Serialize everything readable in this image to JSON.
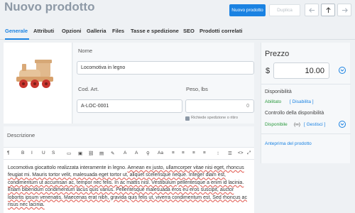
{
  "header": {
    "title": "Nuovo prodotto",
    "create_label": "Nuovo prodotto",
    "duplicate_label": "Duplica"
  },
  "tabs": [
    {
      "label": "Generale"
    },
    {
      "label": "Attributi"
    },
    {
      "label": "Opzioni"
    },
    {
      "label": "Galleria"
    },
    {
      "label": "Files"
    },
    {
      "label": "Tasse e spedizione"
    },
    {
      "label": "SEO"
    },
    {
      "label": "Prodotti correlati"
    }
  ],
  "form": {
    "name_label": "Nome",
    "name_value": "Locomotiva in legno",
    "sku_label": "Cod. Art.",
    "sku_value": "A-LOC-0001",
    "weight_label": "Peso, lbs",
    "weight_value": "0",
    "shipping_required_label": "Richiede spedizione o ritiro",
    "description_label": "Descrizione",
    "description_segments": [
      {
        "text": "Locomotiva giocattolo realizzata interamente in legno. ",
        "u": false
      },
      {
        "text": "Aenean ex justo, ullamcorper vitae nisi eget, rhoncus feugiat mi.",
        "u": true
      },
      {
        "text": " Mauris tortor velit, malesuada eget tortor ut, aliquet scelerisque neque. Integer diam est, condimentum ut accumsan ac, tempor nec felis. In ac mattis nisl. Vestibulum pellentesque a enim id lacinia. Etiam bibendum condimentum lacus quis varius. Pellentesque malesuada eros eu eros suscipit, auctor lobortis ipsum venenatis. Maecenas erat nibh, gravida quis felis ut, viverra condimentum est. Sed rhoncus ac risus nec lacinia.",
        "u": true
      }
    ]
  },
  "toolbar": {
    "items": [
      "¶",
      "B",
      "I",
      "U",
      "S",
      "▭",
      "▣",
      "⛓",
      "▤",
      "✎",
      "A",
      "A",
      "⚲",
      "Aa",
      "≡",
      "≡",
      "≡",
      "≡",
      "⁝",
      "☰",
      "⋮",
      "<>",
      "⤢"
    ]
  },
  "sidebar": {
    "price_label": "Prezzo",
    "currency": "$",
    "price_value": "10.00",
    "availability_label": "Disponibilità",
    "availability_status": "Abilitato",
    "availability_action": "[ Disabilita ]",
    "stock_control_label": "Controllo della disponibilità",
    "stock_status": "Disponibile",
    "stock_symbol": "(∞)",
    "stock_action": "[ Gestisci ]",
    "preview_link": "Anteprima del prodotto"
  },
  "colors": {
    "accent": "#1a82e2",
    "enabled": "#2c9a3f",
    "title": "#8d99a6"
  }
}
